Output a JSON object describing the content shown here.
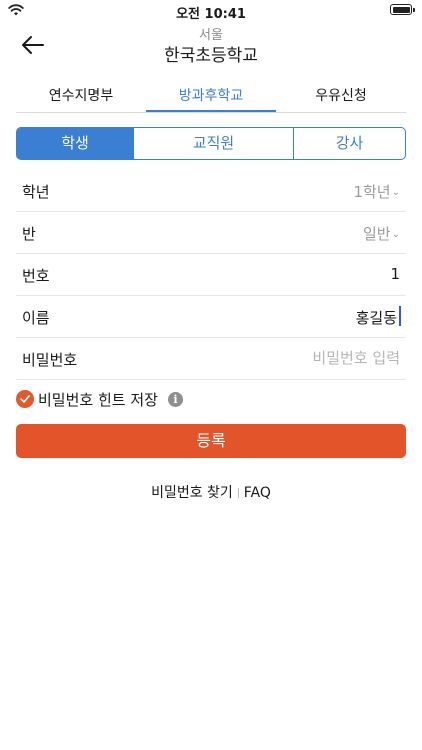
{
  "status_bar": {
    "time": "오전 10:41"
  },
  "header": {
    "subtitle": "서울",
    "title": "한국초등학교"
  },
  "top_tabs": [
    {
      "label": "연수지명부",
      "active": false
    },
    {
      "label": "방과후학교",
      "active": true
    },
    {
      "label": "우유신청",
      "active": false
    }
  ],
  "segment": [
    {
      "label": "학생",
      "active": true
    },
    {
      "label": "교직원",
      "active": false
    },
    {
      "label": "강사",
      "active": false
    }
  ],
  "form": {
    "grade": {
      "label": "학년",
      "value": "1학년"
    },
    "class": {
      "label": "반",
      "value": "일반"
    },
    "number": {
      "label": "번호",
      "value": "1"
    },
    "name": {
      "label": "이름",
      "value": "홍길동"
    },
    "password": {
      "label": "비밀번호",
      "placeholder": "비밀번호 입력"
    }
  },
  "hint": {
    "label": "비밀번호 힌트 저장",
    "checked": true
  },
  "submit_label": "등록",
  "footer": {
    "find_password": "비밀번호 찾기",
    "faq": "FAQ"
  },
  "colors": {
    "accent": "#3a7fd2",
    "primary_button": "#e3542a",
    "check": "#e05a2b"
  }
}
